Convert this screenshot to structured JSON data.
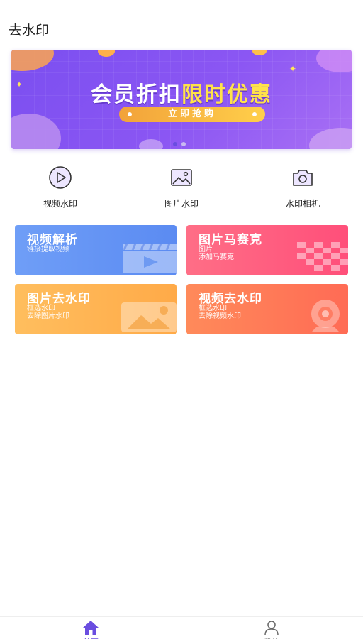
{
  "header": {
    "title": "去水印"
  },
  "banner": {
    "headline_part1": "会员折扣",
    "headline_part2": "限时优惠",
    "button_label": "立即抢购",
    "page_count": 2,
    "active_page": 1
  },
  "quick_actions": [
    {
      "label": "视频水印",
      "icon": "play-circle-icon"
    },
    {
      "label": "图片水印",
      "icon": "image-icon"
    },
    {
      "label": "水印相机",
      "icon": "camera-icon"
    }
  ],
  "cards": [
    {
      "title": "视频解析",
      "subtitle_lines": [
        "链接提取视频"
      ],
      "icon": "clapperboard-icon",
      "color": "#5b8bf2"
    },
    {
      "title": "图片马赛克",
      "subtitle_lines": [
        "图片",
        "添加马赛克"
      ],
      "icon": "mosaic-icon",
      "color": "#ff4f7a"
    },
    {
      "title": "图片去水印",
      "subtitle_lines": [
        "框选水印",
        "去除图片水印"
      ],
      "icon": "picture-icon",
      "color": "#ffaa48"
    },
    {
      "title": "视频去水印",
      "subtitle_lines": [
        "框选水印",
        "去除视频水印"
      ],
      "icon": "webcam-icon",
      "color": "#ff6b55"
    }
  ],
  "tabbar": {
    "tabs": [
      {
        "label": "首页",
        "icon": "home-icon",
        "active": true
      },
      {
        "label": "我的",
        "icon": "user-icon",
        "active": false
      }
    ],
    "accent": "#6a4de0"
  }
}
